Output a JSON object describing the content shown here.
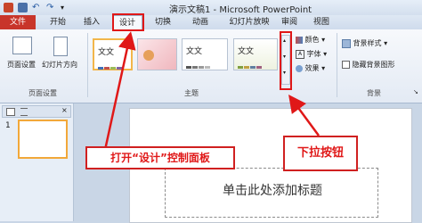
{
  "window": {
    "title": "演示文稿1 - Microsoft PowerPoint"
  },
  "tabs": [
    "文件",
    "开始",
    "插入",
    "设计",
    "切换",
    "动画",
    "幻灯片放映",
    "审阅",
    "视图"
  ],
  "page_setup_group": {
    "page_setup_label": "页面设置",
    "orientation_label": "幻灯片方向",
    "group_label": "页面设置"
  },
  "theme_group": {
    "themes": [
      {
        "text": "文文",
        "colors": [
          "#3f6fb6",
          "#c0504d",
          "#9bbb59",
          "#8064a2"
        ]
      },
      {
        "text": "",
        "colors": []
      },
      {
        "text": "文文",
        "colors": [
          "#555555",
          "#777777",
          "#999999",
          "#bbbbbb"
        ]
      },
      {
        "text": "文文",
        "colors": [
          "#7f9f3f",
          "#c0a040",
          "#607f9f",
          "#a0607f"
        ]
      }
    ],
    "colors_label": "颜色",
    "fonts_label": "字体",
    "effects_label": "效果",
    "group_label": "主题"
  },
  "background_group": {
    "bg_style_label": "背景样式",
    "hide_bg_label": "隐藏背景图形",
    "group_label": "背景"
  },
  "slide_panel": {
    "slide_number": "1"
  },
  "slide": {
    "title_placeholder": "单击此处添加标题"
  },
  "annotations": {
    "design_callout": "打开“设计”控制面板",
    "dropdown_callout": "下拉按钮"
  }
}
